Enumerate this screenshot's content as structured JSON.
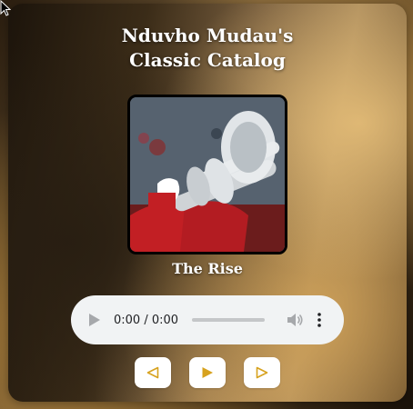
{
  "player": {
    "title_line1": "Nduvho Mudau's",
    "title_line2": "Classic Catalog",
    "track_title": "The Rise",
    "audio": {
      "time_display": "0:00 / 0:00",
      "progress": 0
    },
    "controls": {
      "prev_icon": "prev-triangle-icon",
      "play_icon": "play-triangle-icon",
      "next_icon": "next-triangle-icon"
    }
  },
  "colors": {
    "accent": "#d7a21e",
    "audio_bg": "#f1f3f4",
    "title_text": "#ffffff"
  }
}
